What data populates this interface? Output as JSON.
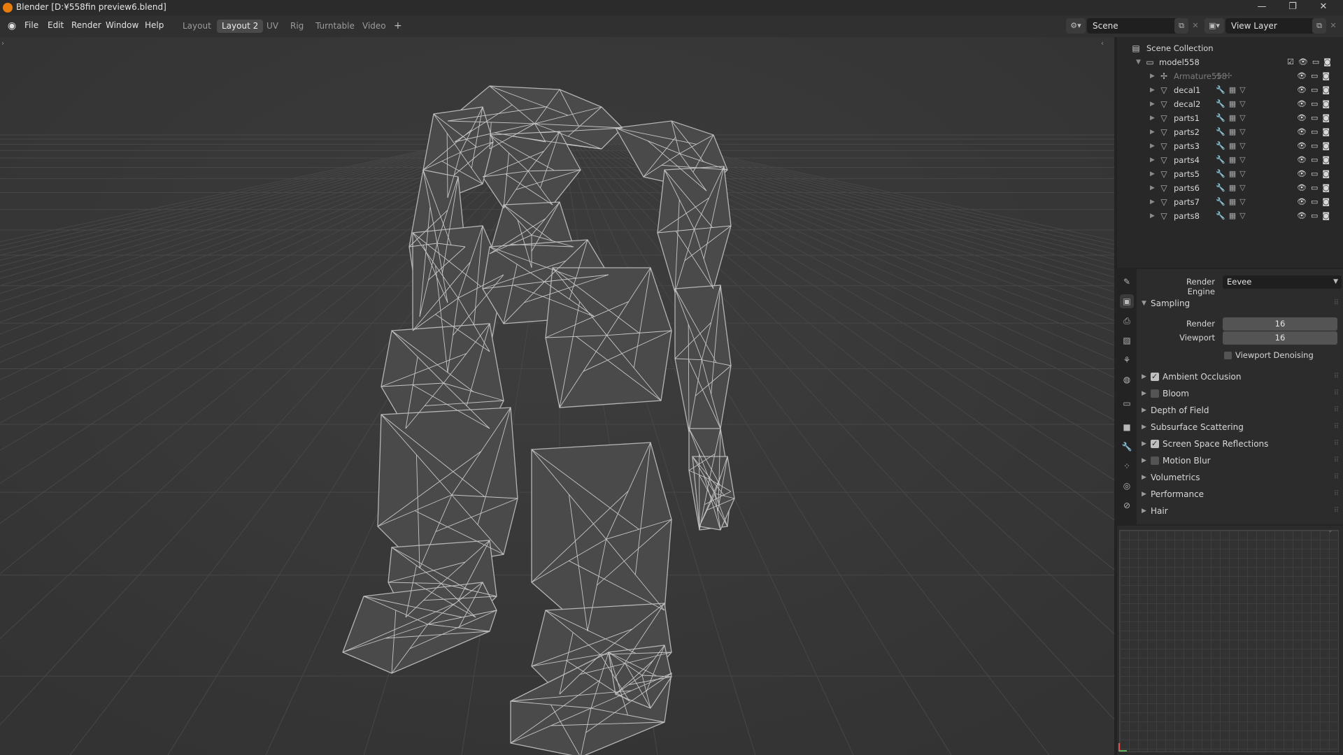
{
  "window": {
    "title": "Blender [D:¥558fin preview6.blend]",
    "controls": [
      "—",
      "❐",
      "✕"
    ]
  },
  "menus": [
    "File",
    "Edit",
    "Render",
    "Window",
    "Help"
  ],
  "workspace_tabs": [
    {
      "label": "Layout",
      "active": false
    },
    {
      "label": "Layout 2",
      "active": true
    },
    {
      "label": "UV",
      "active": false
    },
    {
      "label": "Rig",
      "active": false
    },
    {
      "label": "Turntable",
      "active": false
    },
    {
      "label": "Video",
      "active": false
    }
  ],
  "add_workspace": "+",
  "scene": {
    "name": "Scene"
  },
  "view_layer": {
    "name": "View Layer"
  },
  "outliner": {
    "root": "Scene Collection",
    "collection": "model558",
    "items": [
      {
        "name": "Armature558",
        "kind": "armature",
        "dim": true
      },
      {
        "name": "decal1",
        "kind": "mesh",
        "dim": false
      },
      {
        "name": "decal2",
        "kind": "mesh",
        "dim": false
      },
      {
        "name": "parts1",
        "kind": "mesh",
        "dim": false
      },
      {
        "name": "parts2",
        "kind": "mesh",
        "dim": false
      },
      {
        "name": "parts3",
        "kind": "mesh",
        "dim": false
      },
      {
        "name": "parts4",
        "kind": "mesh",
        "dim": false
      },
      {
        "name": "parts5",
        "kind": "mesh",
        "dim": false
      },
      {
        "name": "parts6",
        "kind": "mesh",
        "dim": false
      },
      {
        "name": "parts7",
        "kind": "mesh",
        "dim": false
      },
      {
        "name": "parts8",
        "kind": "mesh",
        "dim": false
      }
    ]
  },
  "properties": {
    "render_engine_label": "Render Engine",
    "render_engine_value": "Eevee",
    "sampling": {
      "title": "Sampling",
      "render_label": "Render",
      "render_value": "16",
      "viewport_label": "Viewport",
      "viewport_value": "16",
      "denoise_label": "Viewport Denoising"
    },
    "panels": [
      {
        "label": "Ambient Occlusion",
        "checkbox": true,
        "checked": true
      },
      {
        "label": "Bloom",
        "checkbox": true,
        "checked": false
      },
      {
        "label": "Depth of Field",
        "checkbox": false,
        "checked": false
      },
      {
        "label": "Subsurface Scattering",
        "checkbox": false,
        "checked": false
      },
      {
        "label": "Screen Space Reflections",
        "checkbox": true,
        "checked": true
      },
      {
        "label": "Motion Blur",
        "checkbox": true,
        "checked": false
      },
      {
        "label": "Volumetrics",
        "checkbox": false,
        "checked": false
      },
      {
        "label": "Performance",
        "checkbox": false,
        "checked": false
      },
      {
        "label": "Hair",
        "checkbox": false,
        "checked": false
      }
    ]
  },
  "colors": {
    "accent": "#e87d0d",
    "wire": "#b4b4b4",
    "viewport_bg": "#393939"
  }
}
